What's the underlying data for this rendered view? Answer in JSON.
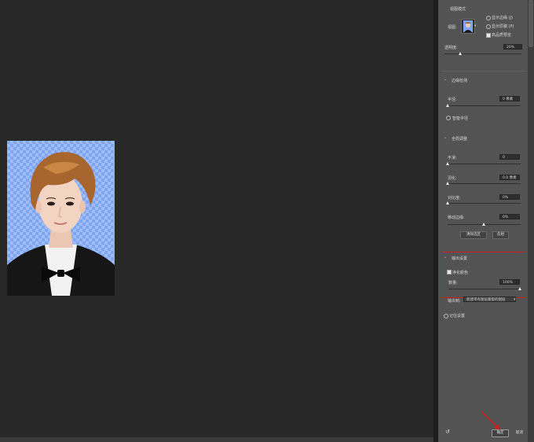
{
  "view_mode": {
    "title": "视图模式",
    "view_label": "视图:",
    "options": [
      "显示边缘 (J)",
      "显示原稿 (P)",
      "高品质预览"
    ],
    "transparency_label": "透明度:",
    "transparency_value": "20%",
    "transparency_level": 0.2
  },
  "edge_detection": {
    "title": "边缘检测",
    "radius_label": "半径:",
    "radius_value": "0 像素",
    "smart_radius_label": "智能半径"
  },
  "global_refine": {
    "title": "全局调整",
    "smooth_label": "平滑:",
    "smooth_value": "0",
    "feather_label": "羽化:",
    "feather_value": "0.0 像素",
    "contrast_label": "对比度:",
    "contrast_value": "0%",
    "shift_edge_label": "移动边缘:",
    "shift_edge_value": "0%",
    "clear_selection_label": "清除选区",
    "invert_label": "反相"
  },
  "output": {
    "title": "输出设置",
    "decontaminate_label": "净化颜色",
    "amount_label": "数量:",
    "amount_value": "100%",
    "amount_level": 1.0,
    "output_to_label": "输出到:",
    "output_to_value": "新建带有图层蒙版的图层",
    "remember_label": "记住设置"
  },
  "footer": {
    "ok_label": "确定",
    "cancel_label": "取消"
  },
  "colors": {
    "highlight_box": "#d01e1e",
    "arrow": "#d01e1e",
    "photo_background": "#7fa6f4"
  }
}
